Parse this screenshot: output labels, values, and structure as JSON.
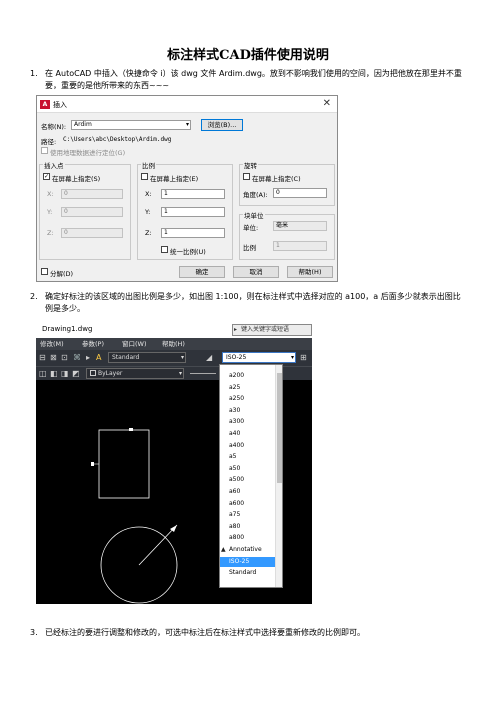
{
  "doc": {
    "title": "标注样式CAD插件使用说明",
    "steps": [
      {
        "num": "1.",
        "text": "在 AutoCAD 中插入（快捷命令 i）该 dwg 文件 Ardim.dwg。放到不影响我们使用的空间，因为把他放在那里并不重要，重要的是他所带来的东西~~~"
      },
      {
        "num": "2.",
        "text": "确定好标注的该区域的出图比例是多少，如出图 1:100，则在标注样式中选择对应的 a100，a 后面多少就表示出图比例是多少。"
      },
      {
        "num": "3.",
        "text": "已经标注的要进行调整和修改的，可选中标注后在标注样式中选择要重新修改的比例即可。"
      }
    ]
  },
  "insert_dialog": {
    "title": "插入",
    "close": "✕",
    "name_label": "名称(N):",
    "name_value": "Ardim",
    "browse_button": "浏览(B)...",
    "path_label": "路径:",
    "path_value": "C:\\Users\\abc\\Desktop\\Ardim.dwg",
    "geo_checkbox": "使用地理数据进行定位(G)",
    "insertion": {
      "group": "插入点",
      "specify": "在屏幕上指定(S)",
      "specify_checked": true,
      "x_label": "X:",
      "x_value": "0",
      "y_label": "Y:",
      "y_value": "0",
      "z_label": "Z:",
      "z_value": "0"
    },
    "scale": {
      "group": "比例",
      "specify": "在屏幕上指定(E)",
      "x_label": "X:",
      "x_value": "1",
      "y_label": "Y:",
      "y_value": "1",
      "z_label": "Z:",
      "z_value": "1",
      "uniform": "统一比例(U)"
    },
    "rotation": {
      "group": "旋转",
      "specify": "在屏幕上指定(C)",
      "angle_label": "角度(A):",
      "angle_value": "0"
    },
    "block_unit": {
      "group": "块单位",
      "unit_label": "单位:",
      "unit_value": "毫米",
      "factor_label": "比例",
      "factor_value": "1"
    },
    "explode": "分解(D)",
    "ok": "确定",
    "cancel": "取消",
    "help": "帮助(H)"
  },
  "autocad": {
    "file_tab": "Drawing1.dwg",
    "search_placeholder": "键入关键字或短语",
    "menu": [
      "修改(M)",
      "参数(P)",
      "窗口(W)",
      "帮助(H)"
    ],
    "text_style": "Standard",
    "dim_style": "ISO-25",
    "layer_value": "ByLayer",
    "dim_style_options": [
      "a200",
      "a25",
      "a250",
      "a30",
      "a300",
      "a40",
      "a400",
      "a5",
      "a50",
      "a500",
      "a60",
      "a600",
      "a75",
      "a80",
      "a800",
      "Annotative",
      "ISO-25",
      "Standard"
    ],
    "selected_option": "ISO-25",
    "colors": {
      "canvas": "#000000",
      "selection": "#3399ff",
      "menubar": "#3b3f46"
    }
  }
}
